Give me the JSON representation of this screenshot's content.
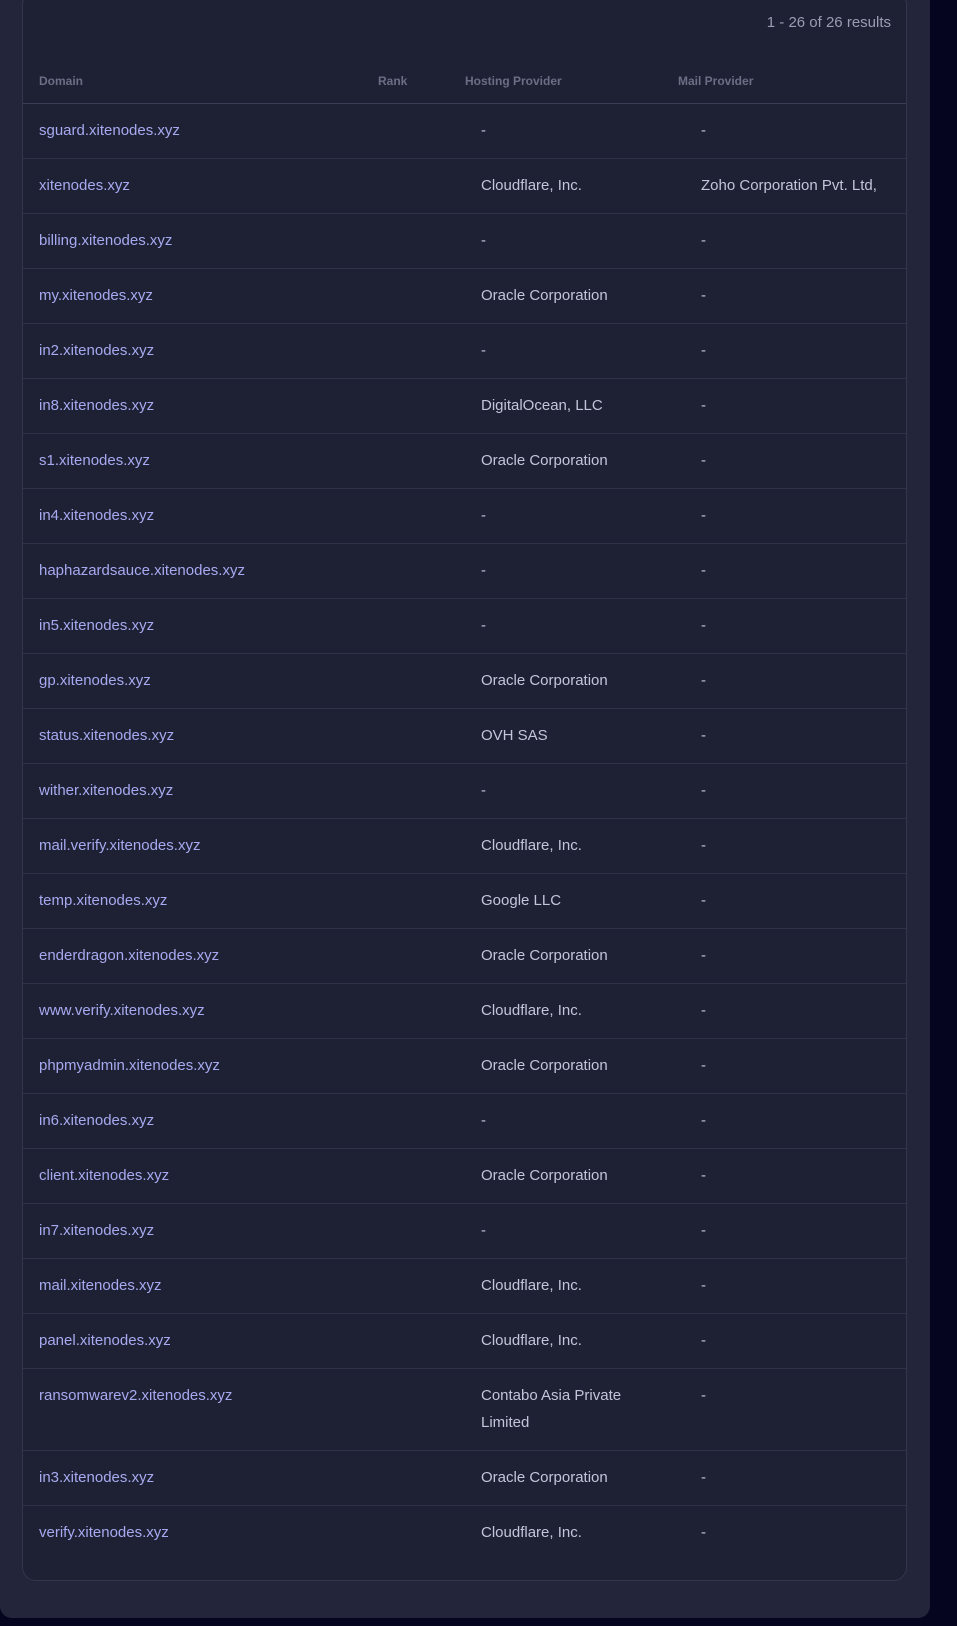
{
  "results_count": "1 - 26 of 26 results",
  "columns": {
    "domain": "Domain",
    "rank": "Rank",
    "hosting": "Hosting Provider",
    "mail": "Mail Provider"
  },
  "rows": [
    {
      "domain": "sguard.xitenodes.xyz",
      "rank": "",
      "hosting": "-",
      "mail": "-"
    },
    {
      "domain": "xitenodes.xyz",
      "rank": "",
      "hosting": "Cloudflare, Inc.",
      "mail": "Zoho Corporation Pvt. Ltd,"
    },
    {
      "domain": "billing.xitenodes.xyz",
      "rank": "",
      "hosting": "-",
      "mail": "-"
    },
    {
      "domain": "my.xitenodes.xyz",
      "rank": "",
      "hosting": "Oracle Corporation",
      "mail": "-"
    },
    {
      "domain": "in2.xitenodes.xyz",
      "rank": "",
      "hosting": "-",
      "mail": "-"
    },
    {
      "domain": "in8.xitenodes.xyz",
      "rank": "",
      "hosting": "DigitalOcean, LLC",
      "mail": "-"
    },
    {
      "domain": "s1.xitenodes.xyz",
      "rank": "",
      "hosting": "Oracle Corporation",
      "mail": "-"
    },
    {
      "domain": "in4.xitenodes.xyz",
      "rank": "",
      "hosting": "-",
      "mail": "-"
    },
    {
      "domain": "haphazardsauce.xitenodes.xyz",
      "rank": "",
      "hosting": "-",
      "mail": "-"
    },
    {
      "domain": "in5.xitenodes.xyz",
      "rank": "",
      "hosting": "-",
      "mail": "-"
    },
    {
      "domain": "gp.xitenodes.xyz",
      "rank": "",
      "hosting": "Oracle Corporation",
      "mail": "-"
    },
    {
      "domain": "status.xitenodes.xyz",
      "rank": "",
      "hosting": "OVH SAS",
      "mail": "-"
    },
    {
      "domain": "wither.xitenodes.xyz",
      "rank": "",
      "hosting": "-",
      "mail": "-"
    },
    {
      "domain": "mail.verify.xitenodes.xyz",
      "rank": "",
      "hosting": "Cloudflare, Inc.",
      "mail": "-"
    },
    {
      "domain": "temp.xitenodes.xyz",
      "rank": "",
      "hosting": "Google LLC",
      "mail": "-"
    },
    {
      "domain": "enderdragon.xitenodes.xyz",
      "rank": "",
      "hosting": "Oracle Corporation",
      "mail": "-"
    },
    {
      "domain": "www.verify.xitenodes.xyz",
      "rank": "",
      "hosting": "Cloudflare, Inc.",
      "mail": "-"
    },
    {
      "domain": "phpmyadmin.xitenodes.xyz",
      "rank": "",
      "hosting": "Oracle Corporation",
      "mail": "-"
    },
    {
      "domain": "in6.xitenodes.xyz",
      "rank": "",
      "hosting": "-",
      "mail": "-"
    },
    {
      "domain": "client.xitenodes.xyz",
      "rank": "",
      "hosting": "Oracle Corporation",
      "mail": "-"
    },
    {
      "domain": "in7.xitenodes.xyz",
      "rank": "",
      "hosting": "-",
      "mail": "-"
    },
    {
      "domain": "mail.xitenodes.xyz",
      "rank": "",
      "hosting": "Cloudflare, Inc.",
      "mail": "-"
    },
    {
      "domain": "panel.xitenodes.xyz",
      "rank": "",
      "hosting": "Cloudflare, Inc.",
      "mail": "-"
    },
    {
      "domain": "ransomwarev2.xitenodes.xyz",
      "rank": "",
      "hosting": "Contabo Asia Private Limited",
      "mail": "-"
    },
    {
      "domain": "in3.xitenodes.xyz",
      "rank": "",
      "hosting": "Oracle Corporation",
      "mail": "-"
    },
    {
      "domain": "verify.xitenodes.xyz",
      "rank": "",
      "hosting": "Cloudflare, Inc.",
      "mail": "-"
    }
  ]
}
